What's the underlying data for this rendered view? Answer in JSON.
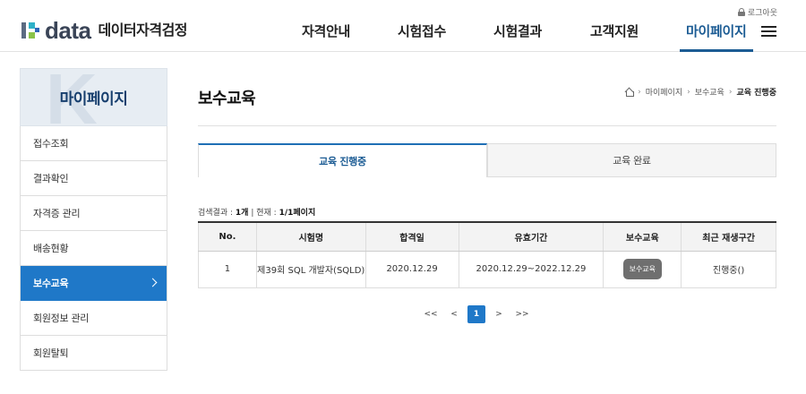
{
  "header": {
    "logo_text": "data",
    "logo_subtitle": "데이터자격검정",
    "logout_label": "로그아웃",
    "nav": [
      {
        "label": "자격안내"
      },
      {
        "label": "시험접수"
      },
      {
        "label": "시험결과"
      },
      {
        "label": "고객지원"
      },
      {
        "label": "마이페이지"
      }
    ],
    "active_nav": "마이페이지"
  },
  "sidebar": {
    "title": "마이페이지",
    "items": [
      {
        "label": "접수조회"
      },
      {
        "label": "결과확인"
      },
      {
        "label": "자격증 관리"
      },
      {
        "label": "배송현황"
      },
      {
        "label": "보수교육"
      },
      {
        "label": "회원정보 관리"
      },
      {
        "label": "회원탈퇴"
      }
    ],
    "active_item": "보수교육"
  },
  "main": {
    "title": "보수교육",
    "breadcrumb": [
      "마이페이지",
      "보수교육",
      "교육 진행중"
    ],
    "tabs": [
      {
        "label": "교육 진행중",
        "active": true
      },
      {
        "label": "교육 완료",
        "active": false
      }
    ],
    "result_count": {
      "prefix": "검색결과 :",
      "count": "1개",
      "divider": "|",
      "current_label": "현재 :",
      "current": "1/1페이지"
    },
    "table": {
      "columns": [
        "No.",
        "시험명",
        "합격일",
        "유효기간",
        "보수교육",
        "최근 재생구간"
      ],
      "rows": [
        {
          "no": "1",
          "exam": "제39회 SQL 개발자(SQLD)",
          "pass_date": "2020.12.29",
          "valid": "2020.12.29~2022.12.29",
          "button": "보수교육",
          "recent": "진행중()"
        }
      ]
    },
    "pagination": {
      "first": "<<",
      "prev": "<",
      "current": "1",
      "next": ">",
      "last": ">>"
    }
  },
  "colors": {
    "brand": "#1c5c94",
    "active_side": "#1f78c8",
    "button_gray": "#6f6f6f"
  }
}
